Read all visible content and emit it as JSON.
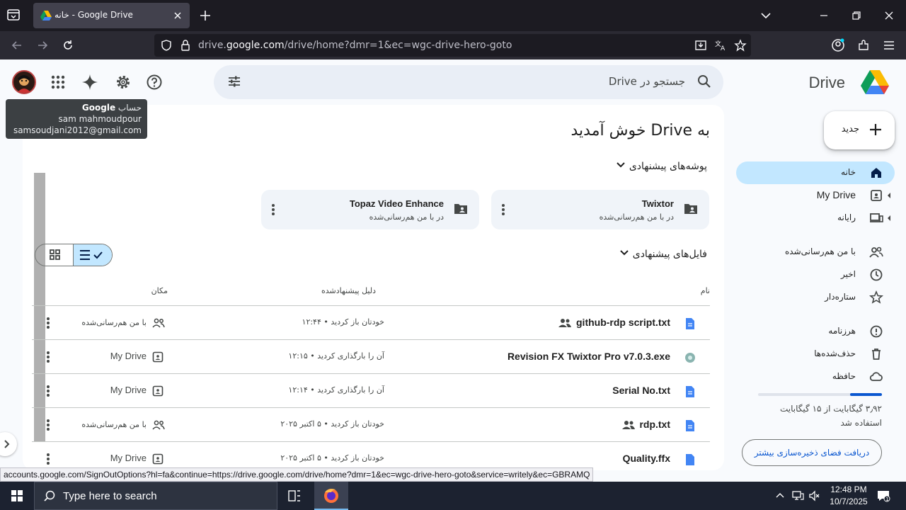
{
  "browser": {
    "tab_title": "خانه - Google Drive",
    "url_prefix": "drive.",
    "url_domain": "google.com",
    "url_path": "/drive/home?dmr=1&ec=wgc-drive-hero-goto",
    "status_url": "accounts.google.com/SignOutOptions?hl=fa&continue=https://drive.google.com/drive/home?dmr=1&ec=wgc-drive-hero-goto&service=writely&ec=GBRAMQ"
  },
  "header": {
    "brand": "Drive",
    "search_placeholder": "جستجو در Drive"
  },
  "tooltip": {
    "label": "حساب",
    "brand": "Google",
    "name": "sam mahmoudpour",
    "email": "samsoudjani2012@gmail.com"
  },
  "sidebar": {
    "new_label": "جدید",
    "items": [
      {
        "label": "خانه",
        "icon": "home-icon",
        "active": true
      },
      {
        "label": "My Drive",
        "icon": "my-drive-icon",
        "active": false
      },
      {
        "label": "رایانه",
        "icon": "computers-icon",
        "active": false
      },
      {
        "label": "با من هم‌رسانی‌شده",
        "icon": "shared-with-me-icon",
        "active": false
      },
      {
        "label": "اخیر",
        "icon": "recent-icon",
        "active": false
      },
      {
        "label": "ستاره‌دار",
        "icon": "starred-icon",
        "active": false
      },
      {
        "label": "هرزنامه",
        "icon": "spam-icon",
        "active": false
      },
      {
        "label": "حذف‌شده‌ها",
        "icon": "trash-icon",
        "active": false
      },
      {
        "label": "حافظه",
        "icon": "storage-icon",
        "active": false
      }
    ],
    "storage_text": "۳٫۹۲ گیگابایت از ۱۵ گیگابایت",
    "storage_used_label": "استفاده شد",
    "storage_fraction": 0.26,
    "get_storage": "دریافت فضای ذخیره‌سازی بیشتر"
  },
  "main": {
    "welcome": "به Drive خوش آمدید",
    "suggested_folders_title": "پوشه‌های پیشنهادی",
    "folders": [
      {
        "name": "Twixtor",
        "subtitle": "در با من هم‌رسانی‌شده"
      },
      {
        "name": "Topaz Video Enhance",
        "subtitle": "در با من هم‌رسانی‌شده"
      }
    ],
    "suggested_files_title": "فایل‌های پیشنهادی",
    "columns": {
      "name": "نام",
      "reason": "دلیل پیشنهادشده",
      "location": "مکان"
    },
    "files": [
      {
        "name": "github-rdp script.txt",
        "shared": true,
        "reason": "خودتان باز کردید • ۱۲:۴۴",
        "location": "با من هم‌رسانی‌شده",
        "loc_fa": true,
        "type": "doc"
      },
      {
        "name": "Revision FX Twixtor Pro v7.0.3.exe",
        "shared": false,
        "reason": "آن را بارگذاری کردید • ۱۲:۱۵",
        "location": "My Drive",
        "loc_fa": false,
        "type": "exe"
      },
      {
        "name": "Serial No.txt",
        "shared": false,
        "reason": "آن را بارگذاری کردید • ۱۲:۱۴",
        "location": "My Drive",
        "loc_fa": false,
        "type": "doc"
      },
      {
        "name": "rdp.txt",
        "shared": true,
        "reason": "خودتان باز کردید • ۵ اکتبر ۲۰۲۵",
        "location": "با من هم‌رسانی‌شده",
        "loc_fa": true,
        "type": "doc"
      },
      {
        "name": "Quality.ffx",
        "shared": false,
        "reason": "خودتان باز کردید • ۵ اکتبر ۲۰۲۵",
        "location": "My Drive",
        "loc_fa": false,
        "type": "doc"
      }
    ]
  },
  "taskbar": {
    "search_placeholder": "Type here to search",
    "time": "12:48 PM",
    "date": "10/7/2025"
  },
  "colors": {
    "accent": "#0b57d0",
    "active_nav": "#c2e7ff",
    "doc_blue": "#4285f4"
  }
}
